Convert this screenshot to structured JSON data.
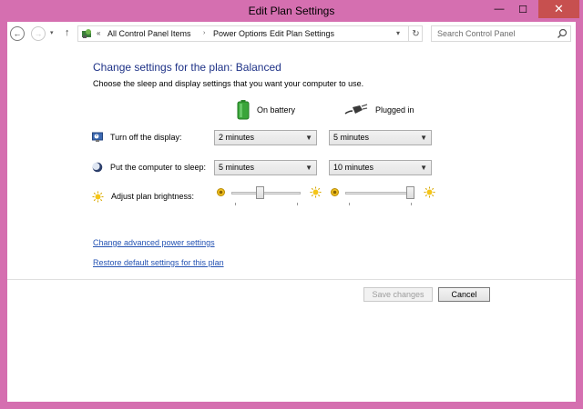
{
  "window": {
    "title": "Edit Plan Settings",
    "controls": {
      "minimize": "—",
      "maximize": "☐",
      "close": "✕"
    }
  },
  "nav": {
    "back_glyph": "←",
    "forward_glyph": "→",
    "recent_glyph": "▾",
    "up_glyph": "↑",
    "address": {
      "prefix": "«",
      "breadcrumbs": [
        "All Control Panel Items",
        "Power Options",
        "Edit Plan Settings"
      ],
      "separator": "›",
      "dropdown_glyph": "▾",
      "refresh_glyph": "↻"
    },
    "search": {
      "placeholder": "Search Control Panel"
    }
  },
  "main": {
    "heading": "Change settings for the plan: Balanced",
    "description": "Choose the sleep and display settings that you want your computer to use.",
    "columns": {
      "battery": "On battery",
      "plugged": "Plugged in"
    },
    "rows": [
      {
        "label": "Turn off the display:",
        "battery": "2 minutes",
        "plugged": "5 minutes"
      },
      {
        "label": "Put the computer to sleep:",
        "battery": "5 minutes",
        "plugged": "10 minutes"
      }
    ],
    "brightness": {
      "label": "Adjust plan brightness:",
      "battery_level": 0.4,
      "plugged_level": 1.0
    },
    "links": {
      "advanced": "Change advanced power settings",
      "restore": "Restore default settings for this plan"
    }
  },
  "footer": {
    "save": "Save changes",
    "cancel": "Cancel"
  },
  "colors": {
    "frame": "#d56fb0",
    "heading": "#1e3287",
    "link": "#2553b3",
    "close": "#c7504f"
  }
}
